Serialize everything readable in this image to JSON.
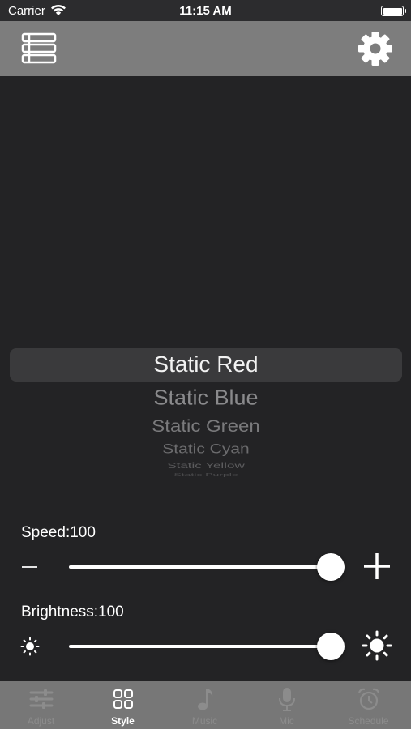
{
  "status_bar": {
    "carrier": "Carrier",
    "time": "11:15 AM"
  },
  "nav_bar": {
    "left_icon": "list-icon",
    "right_icon": "gear-icon"
  },
  "picker": {
    "items": [
      "Static Red",
      "Static Blue",
      "Static Green",
      "Static Cyan",
      "Static Yellow",
      "Static Purple"
    ],
    "selected_index": 0
  },
  "speed": {
    "label": "Speed:100",
    "value": 100,
    "max": 100
  },
  "brightness": {
    "label": "Brightness:100",
    "value": 100,
    "max": 100
  },
  "tabs": [
    {
      "label": "Adjust",
      "icon": "sliders-icon",
      "active": false
    },
    {
      "label": "Style",
      "icon": "grid-icon",
      "active": true
    },
    {
      "label": "Music",
      "icon": "music-note-icon",
      "active": false
    },
    {
      "label": "Mic",
      "icon": "microphone-icon",
      "active": false
    },
    {
      "label": "Schedule",
      "icon": "alarm-clock-icon",
      "active": false
    }
  ],
  "colors": {
    "background": "#232325",
    "nav_bar": "#7d7d7d",
    "tab_bar": "#777777",
    "inactive_tab": "#8c8c8c",
    "active_tab": "#ffffff"
  }
}
